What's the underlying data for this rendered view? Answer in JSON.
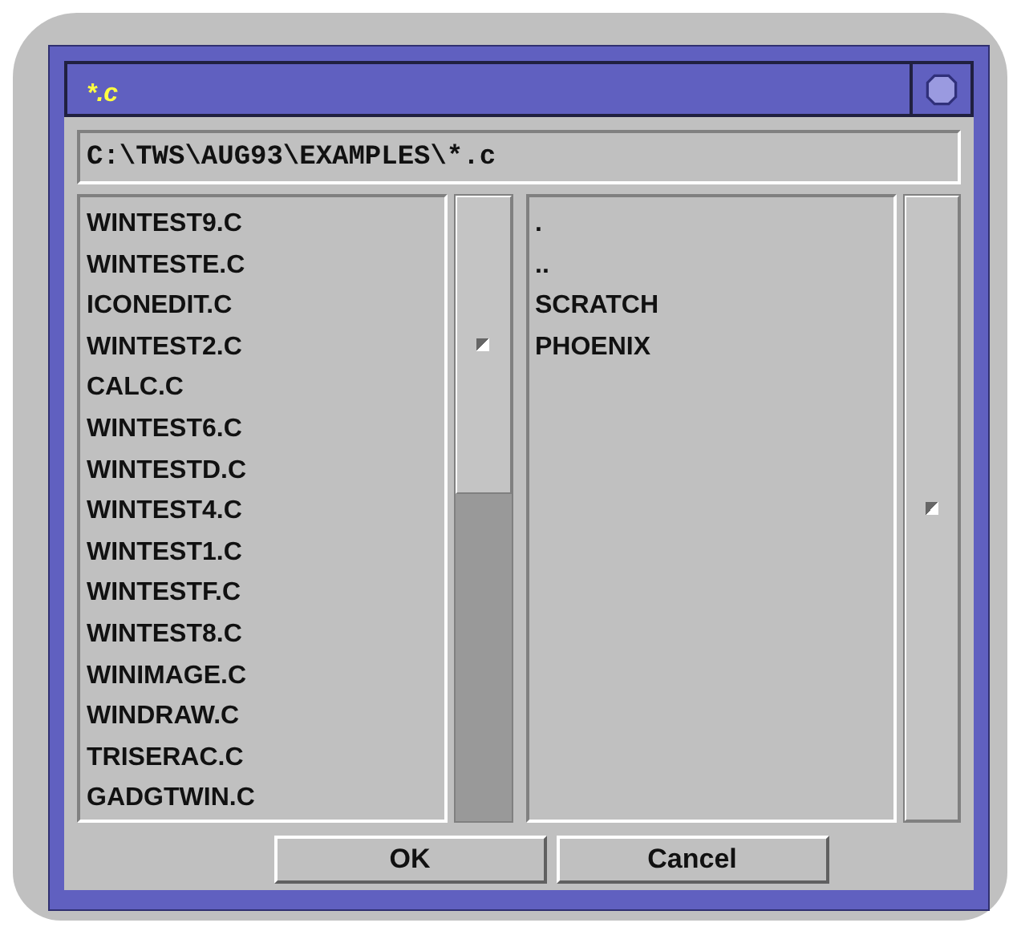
{
  "window": {
    "title": "*.c"
  },
  "path_field": {
    "value": "C:\\TWS\\AUG93\\EXAMPLES\\*.c"
  },
  "files": [
    "WINTEST9.C",
    "WINTESTE.C",
    "ICONEDIT.C",
    "WINTEST2.C",
    "CALC.C",
    "WINTEST6.C",
    "WINTESTD.C",
    "WINTEST4.C",
    "WINTEST1.C",
    "WINTESTF.C",
    "WINTEST8.C",
    "WINIMAGE.C",
    "WINDRAW.C",
    "TRISERAC.C",
    "GADGTWIN.C"
  ],
  "directories": [
    ".",
    "..",
    "SCRATCH",
    "PHOENIX"
  ],
  "buttons": [
    "OK",
    "Cancel"
  ]
}
